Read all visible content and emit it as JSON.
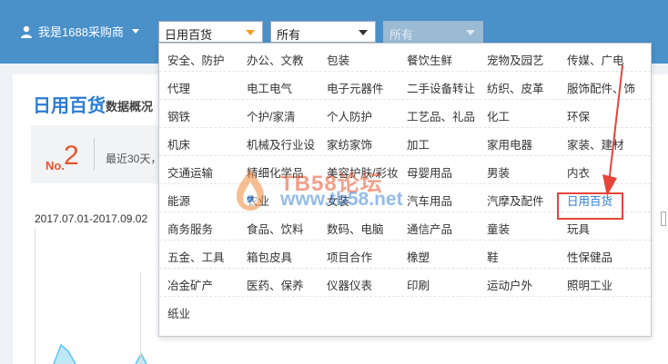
{
  "header": {
    "user_label": "我是1688采购商",
    "select1_value": "日用百货",
    "select2_value": "所有",
    "select3_value": "所有"
  },
  "page": {
    "title": "日用百货",
    "subtitle": "数据概况",
    "rank_prefix": "No.",
    "rank_value": "2",
    "rank_text": "最近30天，",
    "date_range": "2017.07.01-2017.09.02"
  },
  "dropdown": {
    "rows": [
      [
        "安全、防护",
        "办公、文教",
        "包装",
        "餐饮生鲜",
        "宠物及园艺",
        "传媒、广电"
      ],
      [
        "代理",
        "电工电气",
        "电子元器件",
        "二手设备转让",
        "纺织、皮革",
        "服饰配件、饰"
      ],
      [
        "钢铁",
        "个护/家清",
        "个人防护",
        "工艺品、礼品",
        "化工",
        "环保"
      ],
      [
        "机床",
        "机械及行业设",
        "家纺家饰",
        "加工",
        "家用电器",
        "家装、建材"
      ],
      [
        "交通运输",
        "精细化学品",
        "美容护肤/彩妆",
        "母婴用品",
        "男装",
        "内衣"
      ],
      [
        "能源",
        "农业",
        "女装",
        "汽车用品",
        "汽摩及配件",
        "日用百货"
      ],
      [
        "商务服务",
        "食品、饮料",
        "数码、电脑",
        "通信产品",
        "童装",
        "玩具"
      ],
      [
        "五金、工具",
        "箱包皮具",
        "项目合作",
        "橡塑",
        "鞋",
        "性保健品"
      ],
      [
        "冶金矿产",
        "医药、保养",
        "仪器仪表",
        "印刷",
        "运动户外",
        "照明工业"
      ],
      [
        "纸业",
        "",
        "",
        "",
        "",
        ""
      ]
    ],
    "selected": "日用百货"
  },
  "watermark": {
    "title": "TB58论坛",
    "url": "www.tb58.net"
  },
  "colors": {
    "topbar": "#4a90c9",
    "accent_blue": "#2b7cd3",
    "highlight_red": "#e8443a"
  }
}
